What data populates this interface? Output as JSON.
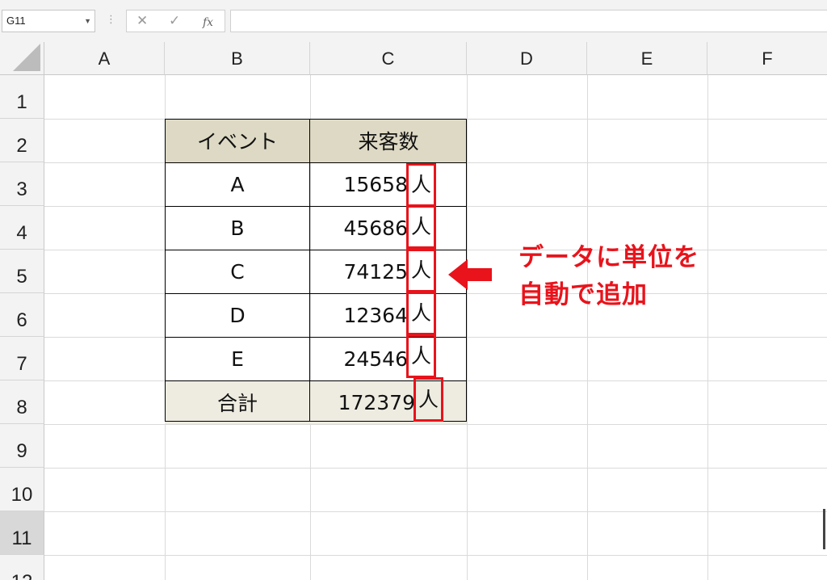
{
  "formula_bar": {
    "name_box": "G11",
    "name_box_dropdown_icon": "triangle-down",
    "more_icon": "vertical-dots",
    "cancel_icon": "cancel-x",
    "enter_icon": "check-mark",
    "fx_label": "fx",
    "formula_text": ""
  },
  "columns": [
    "A",
    "B",
    "C",
    "D",
    "E",
    "F"
  ],
  "rows": [
    "1",
    "2",
    "3",
    "4",
    "5",
    "6",
    "7",
    "8",
    "9",
    "10",
    "11",
    "12"
  ],
  "selected_row": "11",
  "table": {
    "header": {
      "event": "イベント",
      "visitors": "来客数"
    },
    "rows": [
      {
        "event": "A",
        "count": "15658",
        "unit": "人"
      },
      {
        "event": "B",
        "count": "45686",
        "unit": "人"
      },
      {
        "event": "C",
        "count": "74125",
        "unit": "人"
      },
      {
        "event": "D",
        "count": "12364",
        "unit": "人"
      },
      {
        "event": "E",
        "count": "24546",
        "unit": "人"
      }
    ],
    "total": {
      "label": "合計",
      "count": "172379",
      "unit": "人"
    }
  },
  "annotation": {
    "line1": "データに単位を",
    "line2": "自動で追加",
    "color": "#e8131b",
    "arrow_icon": "arrow-left-icon"
  },
  "colors": {
    "header_fill": "#ddd9c4",
    "total_fill": "#eeece1",
    "highlight": "#e8131b"
  }
}
